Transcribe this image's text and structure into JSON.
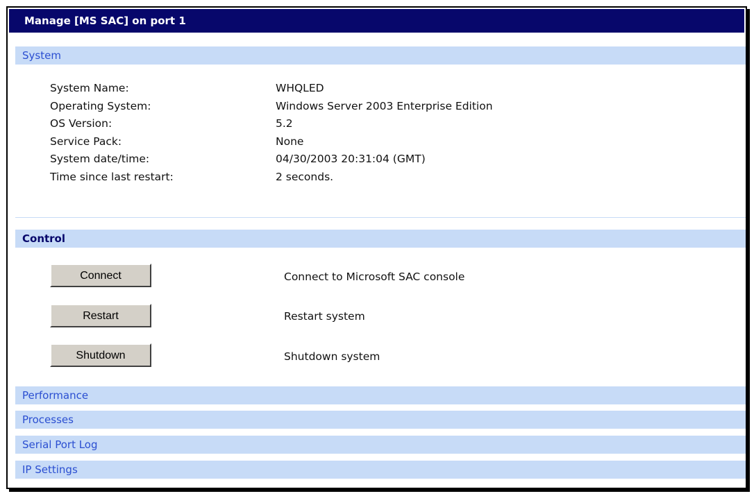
{
  "window": {
    "title": "Manage [MS SAC] on port 1"
  },
  "system": {
    "heading": "System",
    "rows": [
      {
        "label": "System Name:",
        "value": "WHQLED"
      },
      {
        "label": "Operating System:",
        "value": "Windows Server 2003 Enterprise Edition"
      },
      {
        "label": "OS Version:",
        "value": "5.2"
      },
      {
        "label": "Service Pack:",
        "value": "None"
      },
      {
        "label": "System date/time:",
        "value": "04/30/2003 20:31:04 (GMT)"
      },
      {
        "label": "Time since last restart:",
        "value": "2 seconds."
      }
    ]
  },
  "control": {
    "heading": "Control",
    "buttons": [
      {
        "label": "Connect",
        "description": "Connect to Microsoft SAC console"
      },
      {
        "label": "Restart",
        "description": "Restart system"
      },
      {
        "label": "Shutdown",
        "description": "Shutdown system"
      }
    ]
  },
  "nav": {
    "performance": "Performance",
    "processes": "Processes",
    "serial_port_log": "Serial Port Log",
    "ip_settings": "IP Settings"
  },
  "colors": {
    "titlebar": "#07076b",
    "section_band": "#c7dbf7",
    "link": "#2b4fd1"
  }
}
